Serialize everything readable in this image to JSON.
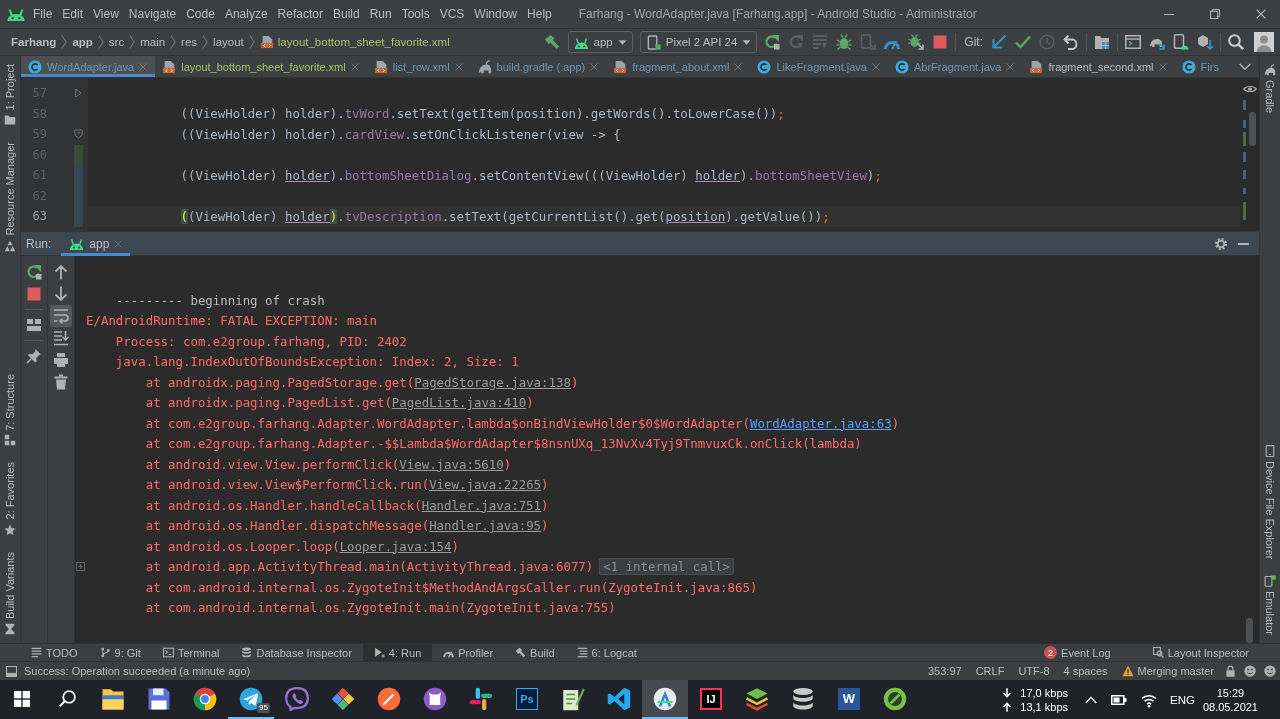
{
  "window": {
    "title": "Farhang - WordAdapter.java [Farhang.app] - Android Studio - Administrator"
  },
  "menu": [
    "File",
    "Edit",
    "View",
    "Navigate",
    "Code",
    "Analyze",
    "Refactor",
    "Build",
    "Run",
    "Tools",
    "VCS",
    "Window",
    "Help"
  ],
  "breadcrumbs": [
    {
      "label": "Farhang",
      "kind": "project"
    },
    {
      "label": "app",
      "kind": "module"
    },
    {
      "label": "src",
      "kind": "folder"
    },
    {
      "label": "main",
      "kind": "folder"
    },
    {
      "label": "res",
      "kind": "folder"
    },
    {
      "label": "layout",
      "kind": "folder"
    },
    {
      "label": "layout_bottom_sheet_favorite.xml",
      "kind": "xml",
      "color": "#a8c26b"
    }
  ],
  "toolbar": {
    "run_config": "app",
    "device": "Pixel 2 API 24",
    "run_actions": [
      {
        "kind": "rerun",
        "disabled": false
      },
      {
        "kind": "apply-changes",
        "disabled": true
      },
      {
        "kind": "apply-code",
        "disabled": true
      },
      {
        "kind": "debug",
        "disabled": false
      },
      {
        "kind": "attach",
        "disabled": true
      },
      {
        "kind": "profile",
        "disabled": false
      },
      {
        "kind": "attach-debugger",
        "disabled": false
      },
      {
        "kind": "stop",
        "disabled": false
      }
    ],
    "vcs_label": "Git:",
    "vcs_actions": [
      {
        "kind": "update",
        "disabled": false
      },
      {
        "kind": "commit",
        "disabled": false
      },
      {
        "kind": "history",
        "disabled": true
      },
      {
        "kind": "rollback",
        "disabled": false
      }
    ],
    "project_actions": [
      {
        "kind": "structure",
        "disabled": false
      }
    ],
    "tool_actions": [
      {
        "kind": "window",
        "disabled": false
      },
      {
        "kind": "sync",
        "disabled": false
      },
      {
        "kind": "devices",
        "disabled": false
      },
      {
        "kind": "sdk",
        "disabled": false
      }
    ]
  },
  "left_strip": {
    "top": [
      {
        "label": "1: Project",
        "kind": "project"
      },
      {
        "label": "Resource Manager",
        "kind": "resources"
      }
    ],
    "bottom": [
      {
        "label": "7: Structure",
        "kind": "structure"
      },
      {
        "label": "2: Favorites",
        "kind": "favorites"
      },
      {
        "label": "Build Variants",
        "kind": "variants"
      }
    ]
  },
  "editor_tabs": [
    {
      "label": "WordAdapter.java",
      "kind": "java",
      "color": "#6897bb",
      "selected": true,
      "cut": false
    },
    {
      "label": "layout_bottom_sheet_favorite.xml",
      "kind": "xml",
      "color": "#a8c26b",
      "selected": false,
      "cut": false
    },
    {
      "label": "list_row.xml",
      "kind": "xml",
      "color": "#6897bb",
      "selected": false,
      "cut": false
    },
    {
      "label": "build.gradle (:app)",
      "kind": "gradle",
      "color": "#6897bb",
      "selected": false,
      "cut": false
    },
    {
      "label": "fragment_about.xml",
      "kind": "xml",
      "color": "#6897bb",
      "selected": false,
      "cut": false
    },
    {
      "label": "LikeFragment.java",
      "kind": "java",
      "color": "#6897bb",
      "selected": false,
      "cut": false
    },
    {
      "label": "AbrFragment.java",
      "kind": "java",
      "color": "#6897bb",
      "selected": false,
      "cut": false
    },
    {
      "label": "fragment_second.xml",
      "kind": "xml",
      "color": "#bbbbbb",
      "selected": false,
      "cut": false
    },
    {
      "label": "Firs",
      "kind": "java",
      "color": "#6897bb",
      "selected": false,
      "cut": true
    }
  ],
  "editor": {
    "lines": [
      {
        "number": "57",
        "current": false,
        "added": false,
        "modified": false,
        "fold_start": false,
        "gutter_arrow": true
      },
      {
        "number": "58",
        "current": false,
        "added": false,
        "modified": false,
        "fold_start": false,
        "gutter_arrow": false,
        "tokens": [
          {
            "text": "((ViewHolder) holder).",
            "kind": "plain"
          },
          {
            "text": "tvWord",
            "kind": "field"
          },
          {
            "text": ".setText(getItem(position).getWords().toLowerCase())",
            "kind": "plain"
          },
          {
            "text": ";",
            "kind": "keyword"
          }
        ]
      },
      {
        "number": "59",
        "current": false,
        "added": false,
        "modified": false,
        "fold_start": true,
        "gutter_arrow": false,
        "tokens": [
          {
            "text": "((ViewHolder) holder).",
            "kind": "plain"
          },
          {
            "text": "cardView",
            "kind": "field"
          },
          {
            "text": ".setOnClickListener(view -> {",
            "kind": "plain"
          }
        ]
      },
      {
        "number": "60",
        "current": false,
        "added": true,
        "modified": false,
        "fold_start": false,
        "gutter_arrow": false
      },
      {
        "number": "61",
        "current": false,
        "added": false,
        "modified": true,
        "fold_start": false,
        "gutter_arrow": false,
        "tokens": [
          {
            "text": "((ViewHolder) ",
            "kind": "plain"
          },
          {
            "text": "holder",
            "kind": "captured"
          },
          {
            "text": ").",
            "kind": "plain"
          },
          {
            "text": "bottomSheetDialog",
            "kind": "field"
          },
          {
            "text": ".setContentView(((ViewHolder) ",
            "kind": "plain"
          },
          {
            "text": "holder",
            "kind": "captured"
          },
          {
            "text": ").",
            "kind": "plain"
          },
          {
            "text": "bottomSheetView",
            "kind": "field"
          },
          {
            "text": ")",
            "kind": "plain"
          },
          {
            "text": ";",
            "kind": "keyword"
          }
        ]
      },
      {
        "number": "62",
        "current": false,
        "added": false,
        "modified": true,
        "fold_start": false,
        "gutter_arrow": false
      },
      {
        "number": "63",
        "current": true,
        "added": false,
        "modified": true,
        "fold_start": false,
        "gutter_arrow": false,
        "tokens": [
          {
            "text": "(",
            "kind": "brace"
          },
          {
            "text": "(ViewHolder) ",
            "kind": "plain"
          },
          {
            "text": "holder",
            "kind": "captured"
          },
          {
            "text": ")",
            "kind": "brace"
          },
          {
            "text": ".",
            "kind": "plain"
          },
          {
            "text": "tvDescription",
            "kind": "field"
          },
          {
            "text": ".setText(getCurrentList().get(",
            "kind": "plain"
          },
          {
            "text": "position",
            "kind": "captured"
          },
          {
            "text": ").getValue())",
            "kind": "plain"
          },
          {
            "text": ";",
            "kind": "keyword"
          }
        ]
      }
    ]
  },
  "run": {
    "title": "Run:",
    "tabs": [
      {
        "label": "app",
        "selected": true
      }
    ],
    "toolbar": [
      {
        "kind": "rerun",
        "selected": false
      },
      {
        "kind": "stop",
        "selected": false
      },
      {
        "kind": "layout",
        "selected": false
      },
      {
        "kind": "pin",
        "selected": false
      }
    ],
    "console_toolbar": [
      {
        "kind": "up",
        "selected": false
      },
      {
        "kind": "down",
        "selected": false
      },
      {
        "kind": "soft-wrap",
        "selected": true
      },
      {
        "kind": "scroll-end",
        "selected": false
      },
      {
        "kind": "print",
        "selected": false
      },
      {
        "kind": "trash",
        "selected": false
      }
    ]
  },
  "console": {
    "lines": [
      {
        "kind": "separator",
        "segments": [
          {
            "text": "--------- beginning of crash",
            "kind": "text"
          }
        ]
      },
      {
        "kind": "fatal",
        "segments": [
          {
            "text": "E/AndroidRuntime: FATAL EXCEPTION: main",
            "kind": "text"
          }
        ]
      },
      {
        "kind": "cause",
        "segments": [
          {
            "text": "Process: com.e2group.farhang, PID: 2402",
            "kind": "text"
          }
        ]
      },
      {
        "kind": "cause",
        "segments": [
          {
            "text": "java.lang.IndexOutOfBoundsException: Index: 2, Size: 1",
            "kind": "text"
          }
        ]
      },
      {
        "kind": "frame",
        "segments": [
          {
            "text": "at androidx.paging.PagedStorage.get(",
            "kind": "text"
          },
          {
            "text": "PagedStorage.java:138",
            "kind": "link"
          },
          {
            "text": ")",
            "kind": "text"
          }
        ]
      },
      {
        "kind": "frame",
        "segments": [
          {
            "text": "at androidx.paging.PagedList.get(",
            "kind": "text"
          },
          {
            "text": "PagedList.java:410",
            "kind": "link"
          },
          {
            "text": ")",
            "kind": "text"
          }
        ]
      },
      {
        "kind": "frame",
        "segments": [
          {
            "text": "at com.e2group.farhang.Adapter.WordAdapter.lambda$onBindViewHolder$0$WordAdapter(",
            "kind": "text"
          },
          {
            "text": "WordAdapter.java:63",
            "kind": "project-link"
          },
          {
            "text": ")",
            "kind": "text"
          }
        ]
      },
      {
        "kind": "frame",
        "segments": [
          {
            "text": "at com.e2group.farhang.Adapter.-$$Lambda$WordAdapter$8nsnUXq_13NvXv4Tyj9TnmvuxCk.onClick(lambda)",
            "kind": "text"
          }
        ]
      },
      {
        "kind": "frame",
        "segments": [
          {
            "text": "at android.view.View.performClick(",
            "kind": "text"
          },
          {
            "text": "View.java:5610",
            "kind": "link"
          },
          {
            "text": ")",
            "kind": "text"
          }
        ]
      },
      {
        "kind": "frame",
        "segments": [
          {
            "text": "at android.view.View$PerformClick.run(",
            "kind": "text"
          },
          {
            "text": "View.java:22265",
            "kind": "link"
          },
          {
            "text": ")",
            "kind": "text"
          }
        ]
      },
      {
        "kind": "frame",
        "segments": [
          {
            "text": "at android.os.Handler.handleCallback(",
            "kind": "text"
          },
          {
            "text": "Handler.java:751",
            "kind": "link"
          },
          {
            "text": ")",
            "kind": "text"
          }
        ]
      },
      {
        "kind": "frame",
        "segments": [
          {
            "text": "at android.os.Handler.dispatchMessage(",
            "kind": "text"
          },
          {
            "text": "Handler.java:95",
            "kind": "link"
          },
          {
            "text": ")",
            "kind": "text"
          }
        ]
      },
      {
        "kind": "frame",
        "segments": [
          {
            "text": "at android.os.Looper.loop(",
            "kind": "text"
          },
          {
            "text": "Looper.java:154",
            "kind": "link"
          },
          {
            "text": ")",
            "kind": "text"
          }
        ]
      },
      {
        "kind": "frame",
        "segments": [
          {
            "text": "at android.app.ActivityThread.main(ActivityThread.java:6077)",
            "kind": "text"
          },
          {
            "text": "<1 internal call>",
            "kind": "folded"
          }
        ]
      },
      {
        "kind": "frame",
        "segments": [
          {
            "text": "at com.android.internal.os.ZygoteInit$MethodAndArgsCaller.run(ZygoteInit.java:865)",
            "kind": "text"
          }
        ]
      },
      {
        "kind": "frame",
        "segments": [
          {
            "text": "at com.android.internal.os.ZygoteInit.main(ZygoteInit.java:755)",
            "kind": "text"
          }
        ]
      }
    ]
  },
  "right_strip": {
    "top": [
      {
        "label": "Gradle",
        "kind": "gradle"
      }
    ],
    "bottom": [
      {
        "label": "Device File Explorer",
        "kind": "device-explorer"
      },
      {
        "label": "Emulator",
        "kind": "emulator"
      }
    ]
  },
  "tool_windows": {
    "left": [
      {
        "label": "TODO",
        "kind": "todo",
        "selected": false
      },
      {
        "label": "9: Git",
        "kind": "git",
        "selected": false
      },
      {
        "label": "Terminal",
        "kind": "terminal",
        "selected": false
      },
      {
        "label": "Database Inspector",
        "kind": "database",
        "selected": false
      },
      {
        "label": "4: Run",
        "kind": "run",
        "selected": true
      },
      {
        "label": "Profiler",
        "kind": "profiler",
        "selected": false
      },
      {
        "label": "Build",
        "kind": "build",
        "selected": false
      },
      {
        "label": "6: Logcat",
        "kind": "logcat",
        "selected": false
      }
    ],
    "right": [
      {
        "label": "Event Log",
        "kind": "event-log",
        "badge": "2"
      },
      {
        "label": "Layout Inspector",
        "kind": "layout-inspector"
      }
    ]
  },
  "status_bar": {
    "message": "Success: Operation succeeded (a minute ago)",
    "position": "353:97",
    "line_separator": "CRLF",
    "encoding": "UTF-8",
    "indent": "4 spaces",
    "vcs": "Merging master"
  },
  "taskbar": {
    "apps": [
      {
        "kind": "folder",
        "selected": false,
        "running": false
      },
      {
        "kind": "floppy",
        "selected": false,
        "running": false
      },
      {
        "kind": "ring",
        "selected": false,
        "running": false
      },
      {
        "kind": "plane",
        "selected": false,
        "running": true,
        "badge": "95"
      },
      {
        "kind": "phone-bubble",
        "selected": false,
        "running": false
      },
      {
        "kind": "diamond",
        "selected": false,
        "running": false
      },
      {
        "kind": "orange-pen",
        "selected": false,
        "running": false
      },
      {
        "kind": "cat",
        "selected": false,
        "running": false
      },
      {
        "kind": "hash",
        "selected": false,
        "running": false
      },
      {
        "kind": "tile-navy",
        "label": "Ps",
        "selected": false,
        "running": false
      },
      {
        "kind": "notepad",
        "selected": false,
        "running": false
      },
      {
        "kind": "ribbon",
        "selected": false,
        "running": false
      },
      {
        "kind": "compass",
        "selected": true,
        "running": true
      },
      {
        "kind": "tile-black",
        "label": "IJ",
        "selected": false,
        "running": false
      },
      {
        "kind": "layers",
        "selected": false,
        "running": false
      },
      {
        "kind": "cylinders",
        "selected": false,
        "running": false
      },
      {
        "kind": "tile-blue",
        "label": "W",
        "selected": false,
        "running": false
      },
      {
        "kind": "green-pen",
        "selected": false,
        "running": false
      }
    ],
    "tray": {
      "download": "17,0 kbps",
      "upload": "13,1 kbps",
      "language": "ENG",
      "time": "15:29",
      "date": "08.05.2021"
    }
  }
}
